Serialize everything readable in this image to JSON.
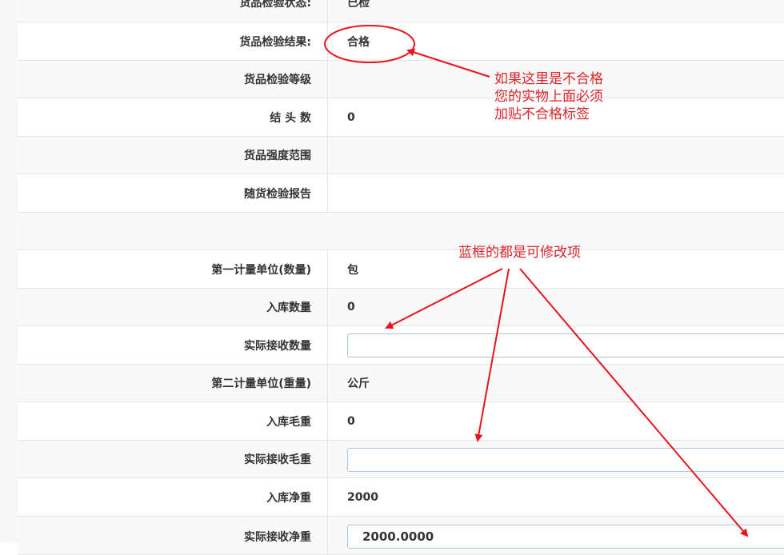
{
  "rows": [
    {
      "label": "货品检验状态:",
      "value": "已检"
    },
    {
      "label": "货品检验结果:",
      "value": "合格"
    },
    {
      "label": "货品检验等级",
      "value": ""
    },
    {
      "label": "结 头 数",
      "value": "0"
    },
    {
      "label": "货品强度范围",
      "value": ""
    },
    {
      "label": "随货检验报告",
      "value": ""
    },
    {
      "label": "",
      "value": ""
    },
    {
      "label": "第一计量单位(数量)",
      "value": "包"
    },
    {
      "label": "入库数量",
      "value": "0"
    },
    {
      "label": "实际接收数量",
      "value": ""
    },
    {
      "label": "第二计量单位(重量)",
      "value": "公斤"
    },
    {
      "label": "入库毛重",
      "value": "0"
    },
    {
      "label": "实际接收毛重",
      "value": ""
    },
    {
      "label": "入库净重",
      "value": "2000"
    },
    {
      "label": "实际接收净重",
      "value": "2000.0000"
    }
  ],
  "annotations": {
    "note1": [
      "如果这里是不合格",
      "您的实物上面必须",
      "加贴不合格标签"
    ],
    "note2": "蓝框的都是可修改项",
    "color": "#d9262b",
    "input_border_color": "#a9c6e8"
  }
}
